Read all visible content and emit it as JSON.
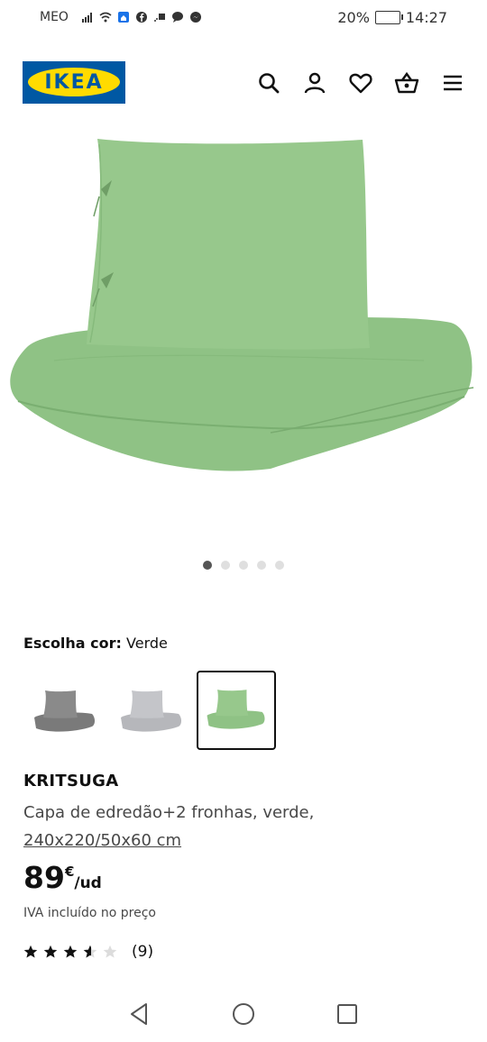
{
  "status_bar": {
    "carrier": "MEO",
    "battery": "20%",
    "time": "14:27"
  },
  "header": {
    "logo_text": "IKEA",
    "brand_blue": "#0058a3",
    "brand_yellow": "#ffdb00",
    "icons": [
      "search-icon",
      "account-icon",
      "heart-icon",
      "basket-icon",
      "menu-icon"
    ]
  },
  "gallery": {
    "image_count": 5,
    "active_index": 0,
    "product_color": "#8fc285"
  },
  "color_selector": {
    "label": "Escolha cor:",
    "value": "Verde",
    "options": [
      {
        "name": "grey",
        "color": "#7a7a7a",
        "selected": false
      },
      {
        "name": "light-grey",
        "color": "#bdbec2",
        "selected": false
      },
      {
        "name": "green",
        "color": "#8fc285",
        "selected": true
      }
    ]
  },
  "product": {
    "name": "KRITSUGA",
    "description": "Capa de edredão+2 fronhas, verde,",
    "size": "240x220/50x60 cm",
    "price_integer": "89",
    "currency": "€",
    "unit": "/ud",
    "vat_note": "IVA incluído no preço",
    "rating": 3.5,
    "rating_max": 5,
    "review_count": "(9)"
  }
}
